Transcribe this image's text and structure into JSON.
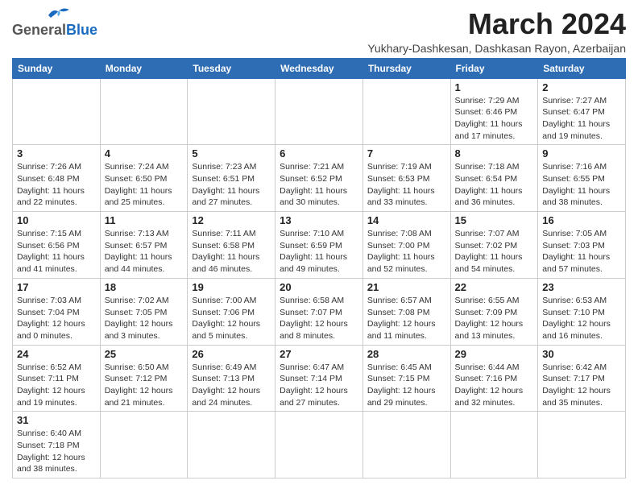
{
  "header": {
    "logo_general": "General",
    "logo_blue": "Blue",
    "month_year": "March 2024",
    "subtitle": "Yukhary-Dashkesan, Dashkasan Rayon, Azerbaijan"
  },
  "weekdays": [
    "Sunday",
    "Monday",
    "Tuesday",
    "Wednesday",
    "Thursday",
    "Friday",
    "Saturday"
  ],
  "weeks": [
    [
      {
        "day": "",
        "info": ""
      },
      {
        "day": "",
        "info": ""
      },
      {
        "day": "",
        "info": ""
      },
      {
        "day": "",
        "info": ""
      },
      {
        "day": "",
        "info": ""
      },
      {
        "day": "1",
        "info": "Sunrise: 7:29 AM\nSunset: 6:46 PM\nDaylight: 11 hours\nand 17 minutes."
      },
      {
        "day": "2",
        "info": "Sunrise: 7:27 AM\nSunset: 6:47 PM\nDaylight: 11 hours\nand 19 minutes."
      }
    ],
    [
      {
        "day": "3",
        "info": "Sunrise: 7:26 AM\nSunset: 6:48 PM\nDaylight: 11 hours\nand 22 minutes."
      },
      {
        "day": "4",
        "info": "Sunrise: 7:24 AM\nSunset: 6:50 PM\nDaylight: 11 hours\nand 25 minutes."
      },
      {
        "day": "5",
        "info": "Sunrise: 7:23 AM\nSunset: 6:51 PM\nDaylight: 11 hours\nand 27 minutes."
      },
      {
        "day": "6",
        "info": "Sunrise: 7:21 AM\nSunset: 6:52 PM\nDaylight: 11 hours\nand 30 minutes."
      },
      {
        "day": "7",
        "info": "Sunrise: 7:19 AM\nSunset: 6:53 PM\nDaylight: 11 hours\nand 33 minutes."
      },
      {
        "day": "8",
        "info": "Sunrise: 7:18 AM\nSunset: 6:54 PM\nDaylight: 11 hours\nand 36 minutes."
      },
      {
        "day": "9",
        "info": "Sunrise: 7:16 AM\nSunset: 6:55 PM\nDaylight: 11 hours\nand 38 minutes."
      }
    ],
    [
      {
        "day": "10",
        "info": "Sunrise: 7:15 AM\nSunset: 6:56 PM\nDaylight: 11 hours\nand 41 minutes."
      },
      {
        "day": "11",
        "info": "Sunrise: 7:13 AM\nSunset: 6:57 PM\nDaylight: 11 hours\nand 44 minutes."
      },
      {
        "day": "12",
        "info": "Sunrise: 7:11 AM\nSunset: 6:58 PM\nDaylight: 11 hours\nand 46 minutes."
      },
      {
        "day": "13",
        "info": "Sunrise: 7:10 AM\nSunset: 6:59 PM\nDaylight: 11 hours\nand 49 minutes."
      },
      {
        "day": "14",
        "info": "Sunrise: 7:08 AM\nSunset: 7:00 PM\nDaylight: 11 hours\nand 52 minutes."
      },
      {
        "day": "15",
        "info": "Sunrise: 7:07 AM\nSunset: 7:02 PM\nDaylight: 11 hours\nand 54 minutes."
      },
      {
        "day": "16",
        "info": "Sunrise: 7:05 AM\nSunset: 7:03 PM\nDaylight: 11 hours\nand 57 minutes."
      }
    ],
    [
      {
        "day": "17",
        "info": "Sunrise: 7:03 AM\nSunset: 7:04 PM\nDaylight: 12 hours\nand 0 minutes."
      },
      {
        "day": "18",
        "info": "Sunrise: 7:02 AM\nSunset: 7:05 PM\nDaylight: 12 hours\nand 3 minutes."
      },
      {
        "day": "19",
        "info": "Sunrise: 7:00 AM\nSunset: 7:06 PM\nDaylight: 12 hours\nand 5 minutes."
      },
      {
        "day": "20",
        "info": "Sunrise: 6:58 AM\nSunset: 7:07 PM\nDaylight: 12 hours\nand 8 minutes."
      },
      {
        "day": "21",
        "info": "Sunrise: 6:57 AM\nSunset: 7:08 PM\nDaylight: 12 hours\nand 11 minutes."
      },
      {
        "day": "22",
        "info": "Sunrise: 6:55 AM\nSunset: 7:09 PM\nDaylight: 12 hours\nand 13 minutes."
      },
      {
        "day": "23",
        "info": "Sunrise: 6:53 AM\nSunset: 7:10 PM\nDaylight: 12 hours\nand 16 minutes."
      }
    ],
    [
      {
        "day": "24",
        "info": "Sunrise: 6:52 AM\nSunset: 7:11 PM\nDaylight: 12 hours\nand 19 minutes."
      },
      {
        "day": "25",
        "info": "Sunrise: 6:50 AM\nSunset: 7:12 PM\nDaylight: 12 hours\nand 21 minutes."
      },
      {
        "day": "26",
        "info": "Sunrise: 6:49 AM\nSunset: 7:13 PM\nDaylight: 12 hours\nand 24 minutes."
      },
      {
        "day": "27",
        "info": "Sunrise: 6:47 AM\nSunset: 7:14 PM\nDaylight: 12 hours\nand 27 minutes."
      },
      {
        "day": "28",
        "info": "Sunrise: 6:45 AM\nSunset: 7:15 PM\nDaylight: 12 hours\nand 29 minutes."
      },
      {
        "day": "29",
        "info": "Sunrise: 6:44 AM\nSunset: 7:16 PM\nDaylight: 12 hours\nand 32 minutes."
      },
      {
        "day": "30",
        "info": "Sunrise: 6:42 AM\nSunset: 7:17 PM\nDaylight: 12 hours\nand 35 minutes."
      }
    ],
    [
      {
        "day": "31",
        "info": "Sunrise: 6:40 AM\nSunset: 7:18 PM\nDaylight: 12 hours\nand 38 minutes."
      },
      {
        "day": "",
        "info": ""
      },
      {
        "day": "",
        "info": ""
      },
      {
        "day": "",
        "info": ""
      },
      {
        "day": "",
        "info": ""
      },
      {
        "day": "",
        "info": ""
      },
      {
        "day": "",
        "info": ""
      }
    ]
  ]
}
